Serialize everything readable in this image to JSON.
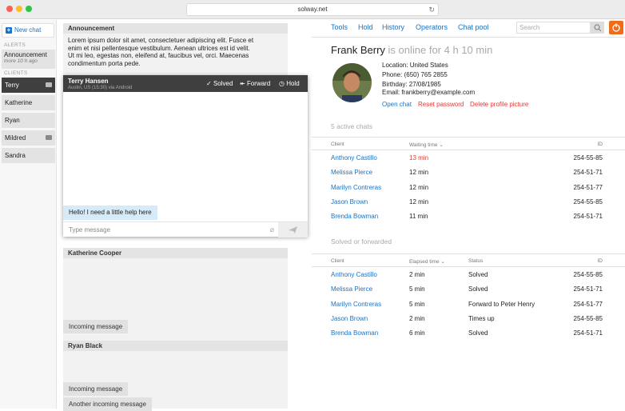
{
  "browser": {
    "url": "solway.net"
  },
  "sidebar": {
    "new_chat": "New chat",
    "alerts_label": "ALERTS",
    "announcement": {
      "title": "Announcement",
      "time": "more 10 h ago"
    },
    "clients_label": "CLIENTS",
    "clients": [
      {
        "name": "Terry",
        "active": true,
        "has_bubble": true
      },
      {
        "name": "Katherine",
        "active": false,
        "has_bubble": false
      },
      {
        "name": "Ryan",
        "active": false,
        "has_bubble": false
      },
      {
        "name": "Mildred",
        "active": false,
        "has_bubble": true
      },
      {
        "name": "Sandra",
        "active": false,
        "has_bubble": false
      }
    ]
  },
  "announcement_panel": {
    "title": "Announcement",
    "lines": [
      "Lorem ipsum dolor sit amet, consectetuer adipiscing elit. Fusce et",
      "enim et nisi pellentesque vestibulum. Aenean ultrices est id velit.",
      "Ut mi leo, egestas non, eleifend at, faucibus vel, orci. Maecenas",
      "condimentum porta pede."
    ]
  },
  "active_chat": {
    "name": "Terry Hansen",
    "subtitle": "Austin, US (15:30) via Android",
    "solved": "Solved",
    "forward": "Forward",
    "hold": "Hold",
    "message": "Hello! I need a little help here",
    "input_placeholder": "Type message"
  },
  "katherine_panel": {
    "title": "Katherine Cooper",
    "message": "Incoming message"
  },
  "ryan_panel": {
    "title": "Ryan Black",
    "messages": [
      "Incoming message",
      "Another incoming message"
    ]
  },
  "nav": {
    "tools": "Tools",
    "hold": "Hold",
    "history": "History",
    "operators": "Operators",
    "chat_pool": "Chat pool",
    "search_placeholder": "Search"
  },
  "profile": {
    "name": "Frank Berry",
    "status": "is online for 4 h 10 min",
    "location": "Location: United States",
    "phone": "Phone: (650) 765 2855",
    "birthday": "Birthday: 27/08/1985",
    "email": "Email: frankberry@example.com",
    "open_chat": "Open chat",
    "reset_password": "Reset password",
    "delete_picture": "Delete profile picture"
  },
  "active_chats": {
    "label": "5 active chats",
    "headers": {
      "client": "Client",
      "waiting": "Waiting time",
      "id": "ID"
    },
    "rows": [
      {
        "client": "Anthony Castillo",
        "time": "13 min",
        "id": "254-55-85",
        "urgent": true
      },
      {
        "client": "Melissa Pierce",
        "time": "12 min",
        "id": "254-51-71",
        "urgent": false
      },
      {
        "client": "Marilyn Contreras",
        "time": "12 min",
        "id": "254-51-77",
        "urgent": false
      },
      {
        "client": "Jason Brown",
        "time": "12 min",
        "id": "254-55-85",
        "urgent": false
      },
      {
        "client": "Brenda Bowman",
        "time": "11 min",
        "id": "254-51-71",
        "urgent": false
      }
    ]
  },
  "solved": {
    "label": "Solved or forwarded",
    "headers": {
      "client": "Client",
      "elapsed": "Elapsed time",
      "status": "Status",
      "id": "ID"
    },
    "rows": [
      {
        "client": "Anthony Castillo",
        "time": "2 min",
        "status": "Solved",
        "id": "254-55-85"
      },
      {
        "client": "Melissa Pierce",
        "time": "5 min",
        "status": "Solved",
        "id": "254-51-71"
      },
      {
        "client": "Marilyn Contreras",
        "time": "5 min",
        "status": "Forward to Peter Henry",
        "id": "254-51-77"
      },
      {
        "client": "Jason Brown",
        "time": "2 min",
        "status": "Times up",
        "id": "254-55-85"
      },
      {
        "client": "Brenda Bowman",
        "time": "6 min",
        "status": "Solved",
        "id": "254-51-71"
      }
    ]
  },
  "colors": {
    "accent": "#1a73c7",
    "danger": "#e53935",
    "orange": "#ef6c1a"
  }
}
